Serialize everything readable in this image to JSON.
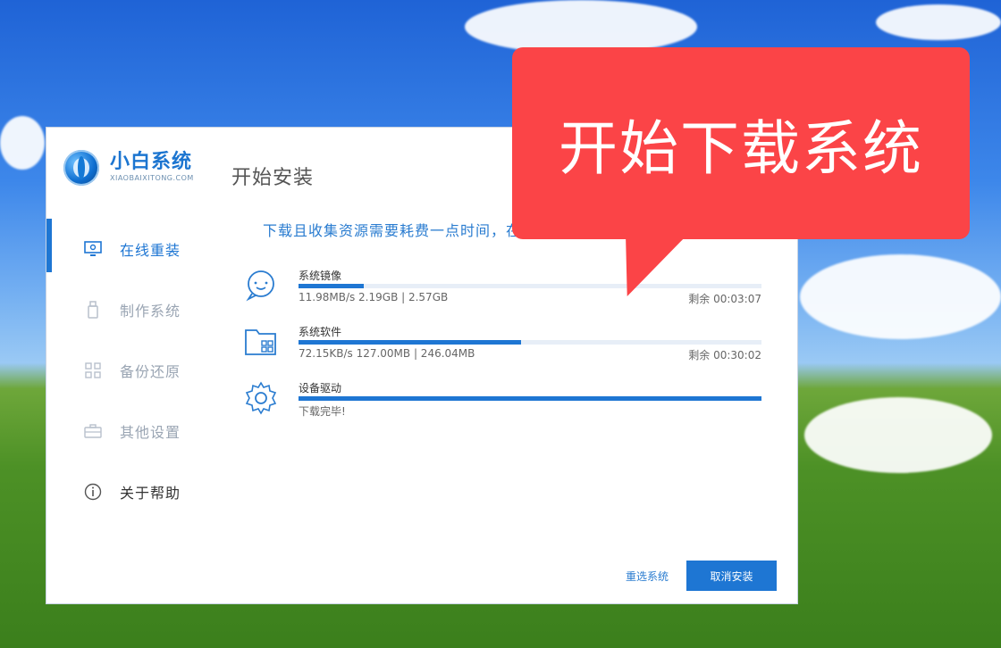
{
  "app": {
    "brand": "小白系统",
    "brand_sub": "XIAOBAIXITONG.COM",
    "page_title": "开始安装"
  },
  "sidebar": {
    "items": [
      {
        "label": "在线重装",
        "icon": "monitor-icon"
      },
      {
        "label": "制作系统",
        "icon": "usb-icon"
      },
      {
        "label": "备份还原",
        "icon": "grid-icon"
      },
      {
        "label": "其他设置",
        "icon": "briefcase-icon"
      },
      {
        "label": "关于帮助",
        "icon": "info-icon"
      }
    ]
  },
  "main": {
    "info": "下载且收集资源需要耗费一点时间，在",
    "tasks": [
      {
        "name": "系统镜像",
        "stats": "11.98MB/s 2.19GB | 2.57GB",
        "remaining": "剩余 00:03:07",
        "progress": 0.14,
        "icon": "smile-face-icon"
      },
      {
        "name": "系统软件",
        "stats": "72.15KB/s 127.00MB | 246.04MB",
        "remaining": "剩余 00:30:02",
        "progress": 0.48,
        "icon": "folder-apps-icon"
      },
      {
        "name": "设备驱动",
        "stats": "下载完毕!",
        "remaining": "",
        "progress": 1.0,
        "icon": "gear-icon"
      }
    ]
  },
  "buttons": {
    "reselect": "重选系统",
    "cancel": "取消安装"
  },
  "callout": {
    "text": "开始下载系统"
  },
  "colors": {
    "accent": "#1e76d3",
    "callout": "#fb4447"
  }
}
